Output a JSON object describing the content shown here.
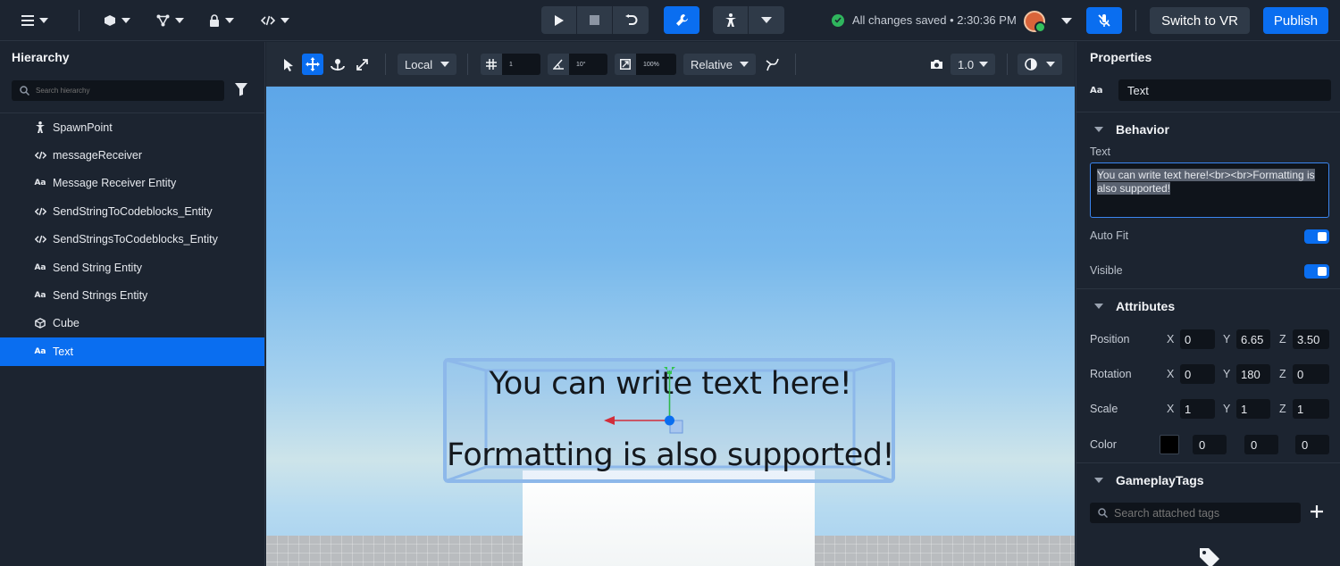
{
  "topbar": {
    "save_status": "All changes saved • 2:30:36 PM",
    "switch_vr_label": "Switch to VR",
    "publish_label": "Publish",
    "accent_color": "#0a6ef0"
  },
  "hierarchy": {
    "title": "Hierarchy",
    "search_placeholder": "Search hierarchy",
    "items": [
      {
        "label": "SpawnPoint",
        "icon": "spawn-icon"
      },
      {
        "label": "messageReceiver",
        "icon": "code-icon"
      },
      {
        "label": "Message Receiver Entity",
        "icon": "text-icon"
      },
      {
        "label": "SendStringToCodeblocks_Entity",
        "icon": "code-icon"
      },
      {
        "label": "SendStringsToCodeblocks_Entity",
        "icon": "code-icon"
      },
      {
        "label": "Send String Entity",
        "icon": "text-icon"
      },
      {
        "label": "Send Strings Entity",
        "icon": "text-icon"
      },
      {
        "label": "Cube",
        "icon": "cube-icon"
      },
      {
        "label": "Text",
        "icon": "text-icon",
        "selected": true
      }
    ]
  },
  "viewport_toolbar": {
    "space": "Local",
    "grid_value": "1",
    "angle_value": "10°",
    "scale_value": "100%",
    "pivot": "Relative",
    "camera_speed": "1.0"
  },
  "scene": {
    "line1": "You can write text here!",
    "line2": "Formatting is also supported!"
  },
  "properties": {
    "title": "Properties",
    "name": "Text",
    "behavior": {
      "section": "Behavior",
      "text_label": "Text",
      "text_value": "You can write text here!<br><br>Formatting is also supported!",
      "autofit_label": "Auto Fit",
      "visible_label": "Visible"
    },
    "attributes": {
      "section": "Attributes",
      "position_label": "Position",
      "position": {
        "x": "0",
        "y": "6.65",
        "z": "3.50"
      },
      "rotation_label": "Rotation",
      "rotation": {
        "x": "0",
        "y": "180",
        "z": "0"
      },
      "scale_label": "Scale",
      "scale": {
        "x": "1",
        "y": "1",
        "z": "1"
      },
      "color_label": "Color",
      "color": {
        "r": "0",
        "g": "0",
        "b": "0"
      },
      "axis_x": "X",
      "axis_y": "Y",
      "axis_z": "Z"
    },
    "gameplay_tags": {
      "section": "GameplayTags",
      "search_placeholder": "Search attached tags"
    }
  }
}
